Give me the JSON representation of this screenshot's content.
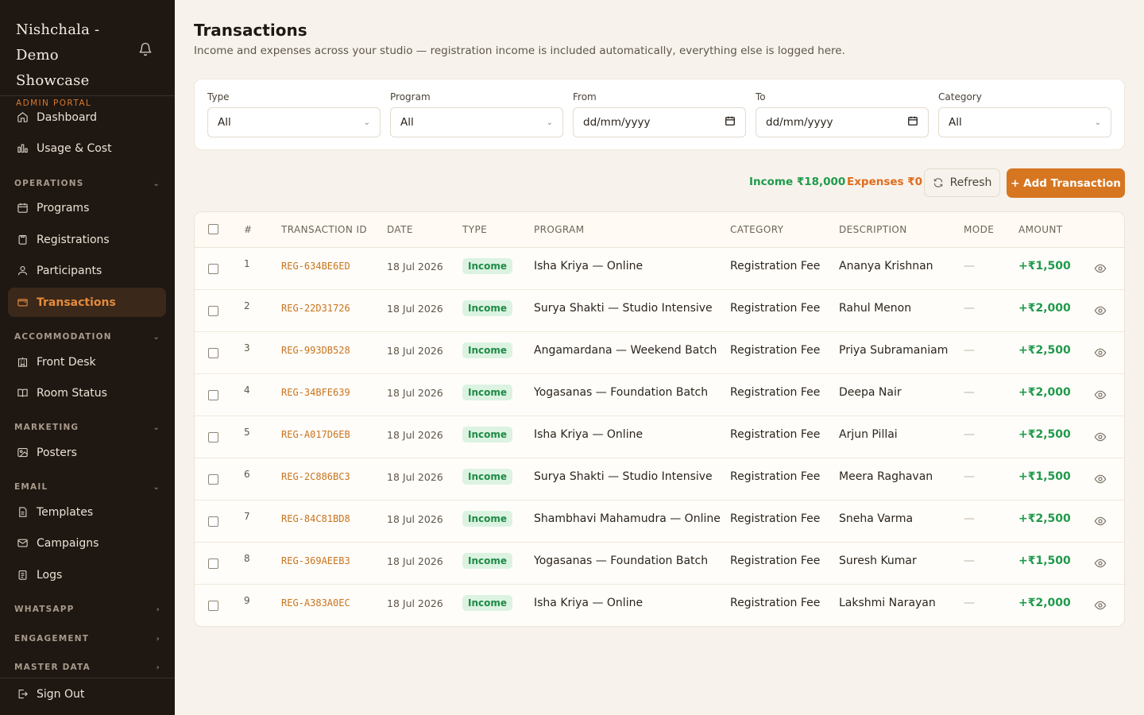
{
  "sidebar": {
    "brand_title": "Nishchala - Demo Showcase",
    "brand_sub": "ADMIN PORTAL",
    "items_top": [
      {
        "label": "Dashboard",
        "icon": "home-icon"
      },
      {
        "label": "Usage & Cost",
        "icon": "bar-chart-icon"
      }
    ],
    "sections": [
      {
        "title": "OPERATIONS",
        "items": [
          "Programs",
          "Registrations",
          "Participants",
          "Transactions"
        ]
      },
      {
        "title": "ACCOMMODATION",
        "items": [
          "Front Desk",
          "Room Status"
        ]
      },
      {
        "title": "MARKETING",
        "items": [
          "Posters"
        ]
      },
      {
        "title": "EMAIL",
        "items": [
          "Templates",
          "Campaigns",
          "Logs"
        ]
      },
      {
        "title": "WHATSAPP",
        "items": []
      },
      {
        "title": "ENGAGEMENT",
        "items": []
      },
      {
        "title": "MASTER DATA",
        "items": []
      }
    ],
    "active": "Transactions",
    "sign_out": "Sign Out"
  },
  "header": {
    "title": "Transactions",
    "subtitle": "Income and expenses across your studio — registration income is included automatically, everything else is logged here."
  },
  "filters": [
    {
      "label": "Type",
      "value": "All",
      "kind": "select"
    },
    {
      "label": "Program",
      "value": "All",
      "kind": "select"
    },
    {
      "label": "From",
      "value": "dd/mm/yyyy",
      "kind": "date"
    },
    {
      "label": "To",
      "value": "dd/mm/yyyy",
      "kind": "date"
    },
    {
      "label": "Category",
      "value": "All",
      "kind": "select"
    }
  ],
  "toolbar": {
    "income": "Income ₹18,000",
    "expenses": "Expenses ₹0",
    "refresh": "Refresh",
    "add": "+ Add Transaction"
  },
  "table": {
    "columns": [
      "#",
      "TRANSACTION ID",
      "DATE",
      "TYPE",
      "PROGRAM",
      "CATEGORY",
      "DESCRIPTION",
      "MODE",
      "AMOUNT"
    ],
    "rows": [
      {
        "n": "1",
        "id": "REG-634BE6ED",
        "date": "18 Jul 2026",
        "type": "Income",
        "program": "Isha Kriya — Online",
        "category": "Registration Fee",
        "description": "Ananya Krishnan",
        "mode": "—",
        "amount": "+₹1,500"
      },
      {
        "n": "2",
        "id": "REG-22D31726",
        "date": "18 Jul 2026",
        "type": "Income",
        "program": "Surya Shakti — Studio Intensive",
        "category": "Registration Fee",
        "description": "Rahul Menon",
        "mode": "—",
        "amount": "+₹2,000"
      },
      {
        "n": "3",
        "id": "REG-993DB528",
        "date": "18 Jul 2026",
        "type": "Income",
        "program": "Angamardana — Weekend Batch",
        "category": "Registration Fee",
        "description": "Priya Subramaniam",
        "mode": "—",
        "amount": "+₹2,500"
      },
      {
        "n": "4",
        "id": "REG-34BFE639",
        "date": "18 Jul 2026",
        "type": "Income",
        "program": "Yogasanas — Foundation Batch",
        "category": "Registration Fee",
        "description": "Deepa Nair",
        "mode": "—",
        "amount": "+₹2,000"
      },
      {
        "n": "5",
        "id": "REG-A017D6EB",
        "date": "18 Jul 2026",
        "type": "Income",
        "program": "Isha Kriya — Online",
        "category": "Registration Fee",
        "description": "Arjun Pillai",
        "mode": "—",
        "amount": "+₹2,500"
      },
      {
        "n": "6",
        "id": "REG-2C886BC3",
        "date": "18 Jul 2026",
        "type": "Income",
        "program": "Surya Shakti — Studio Intensive",
        "category": "Registration Fee",
        "description": "Meera Raghavan",
        "mode": "—",
        "amount": "+₹1,500"
      },
      {
        "n": "7",
        "id": "REG-84C81BD8",
        "date": "18 Jul 2026",
        "type": "Income",
        "program": "Shambhavi Mahamudra — Online",
        "category": "Registration Fee",
        "description": "Sneha Varma",
        "mode": "—",
        "amount": "+₹2,500"
      },
      {
        "n": "8",
        "id": "REG-369AEEB3",
        "date": "18 Jul 2026",
        "type": "Income",
        "program": "Yogasanas — Foundation Batch",
        "category": "Registration Fee",
        "description": "Suresh Kumar",
        "mode": "—",
        "amount": "+₹1,500"
      },
      {
        "n": "9",
        "id": "REG-A383A0EC",
        "date": "18 Jul 2026",
        "type": "Income",
        "program": "Isha Kriya — Online",
        "category": "Registration Fee",
        "description": "Lakshmi Narayan",
        "mode": "—",
        "amount": "+₹2,000"
      }
    ]
  },
  "colors": {
    "sidebar_bg": "#1e1712",
    "accent": "#d77621",
    "income_green": "#1f9a4c",
    "expense_orange": "#e06c1e"
  }
}
